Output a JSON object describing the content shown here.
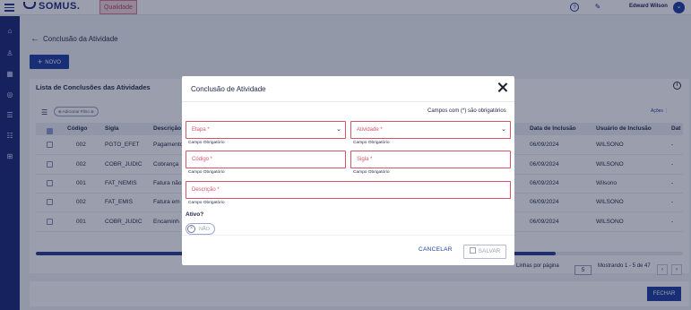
{
  "topbar": {
    "logo_text": "SOMUS.",
    "badge": "Qualidade",
    "user_name": "Edward Wilson",
    "avatar_glyph": "⌄"
  },
  "page": {
    "title": "Conclusão da Atividade",
    "new_button": "NOVO"
  },
  "list": {
    "title": "Lista de Conclusões das Atividades",
    "filter_chip": "Adicionar Filtro",
    "actions_label": "Ações",
    "columns": [
      "Código",
      "Sigla",
      "Descrição",
      "Data de Inclusão",
      "Usuário de Inclusão",
      "Dat"
    ],
    "rows": [
      {
        "codigo": "002",
        "sigla": "PGTO_EFET",
        "descricao": "Pagamento",
        "data": "06/09/2024",
        "usuario": "WILSONO",
        "extra": "-"
      },
      {
        "codigo": "002",
        "sigla": "COBR_JUDIC",
        "descricao": "Cobrança",
        "data": "06/09/2024",
        "usuario": "WILSONO",
        "extra": "-"
      },
      {
        "codigo": "001",
        "sigla": "FAT_NEMIS",
        "descricao": "Fatura não",
        "data": "06/09/2024",
        "usuario": "Wilsono",
        "extra": "-"
      },
      {
        "codigo": "002",
        "sigla": "FAT_EMIS",
        "descricao": "Fatura em",
        "data": "06/09/2024",
        "usuario": "WILSONO",
        "extra": "-"
      },
      {
        "codigo": "001",
        "sigla": "COBR_JUDIC",
        "descricao": "Encaminh",
        "data": "06/09/2024",
        "usuario": "WILSONO",
        "extra": "-"
      }
    ],
    "rows_per_page_label": "Linhas por página",
    "rows_per_page": "5",
    "showing": "Mostrando 1 - 5 de 47"
  },
  "footer": {
    "close_button": "FECHAR"
  },
  "modal": {
    "title": "Conclusão de Atividade",
    "required_note": "Campos com (*) são obrigatórios",
    "fields": {
      "etapa": "Etapa *",
      "atividade": "Atividade *",
      "codigo": "Código *",
      "sigla": "Sigla *",
      "descricao": "Descrição *"
    },
    "help_text": "Campo Obrigatório",
    "ativo_label": "Ativo?",
    "toggle_text": "NÃO",
    "cancel_button": "CANCELAR",
    "save_button": "SALVAR"
  },
  "colors": {
    "primary": "#1f3ea0",
    "sidebar": "#1a2a78",
    "error": "#d9536a"
  }
}
